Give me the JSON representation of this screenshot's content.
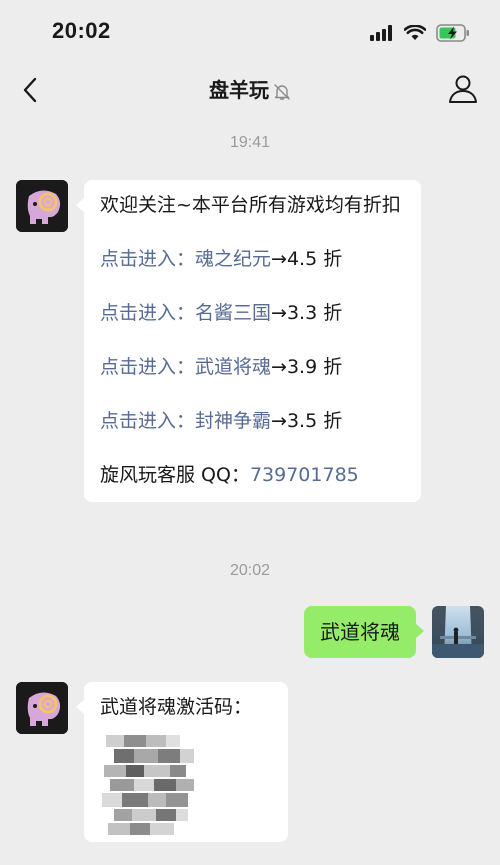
{
  "status": {
    "time": "20:02"
  },
  "header": {
    "title": "盘羊玩"
  },
  "chat": {
    "timestamp1": "19:41",
    "welcome": {
      "intro": "欢迎关注~本平台所有游戏均有折扣",
      "games": [
        {
          "prefix": "点击进入：",
          "name": "魂之纪元",
          "discount": "→4.5 折"
        },
        {
          "prefix": "点击进入：",
          "name": "名酱三国",
          "discount": "→3.3 折"
        },
        {
          "prefix": "点击进入：",
          "name": "武道将魂",
          "discount": "→3.9 折"
        },
        {
          "prefix": "点击进入：",
          "name": "封神争霸",
          "discount": "→3.5 折"
        }
      ],
      "service_label": "旋风玩客服 QQ：",
      "service_qq": "739701785"
    },
    "timestamp2": "20:02",
    "sent_message": "武道将魂",
    "reply_message": "武道将魂激活码："
  },
  "colors": {
    "background": "#ededed",
    "bubble_self": "#95ec69",
    "bubble_other": "#ffffff",
    "link": "#576b95",
    "timestamp": "#9b9b9b"
  },
  "icons": [
    "back-arrow-icon",
    "mute-bell-icon",
    "profile-icon",
    "signal-icon",
    "wifi-icon",
    "battery-charging-icon"
  ]
}
